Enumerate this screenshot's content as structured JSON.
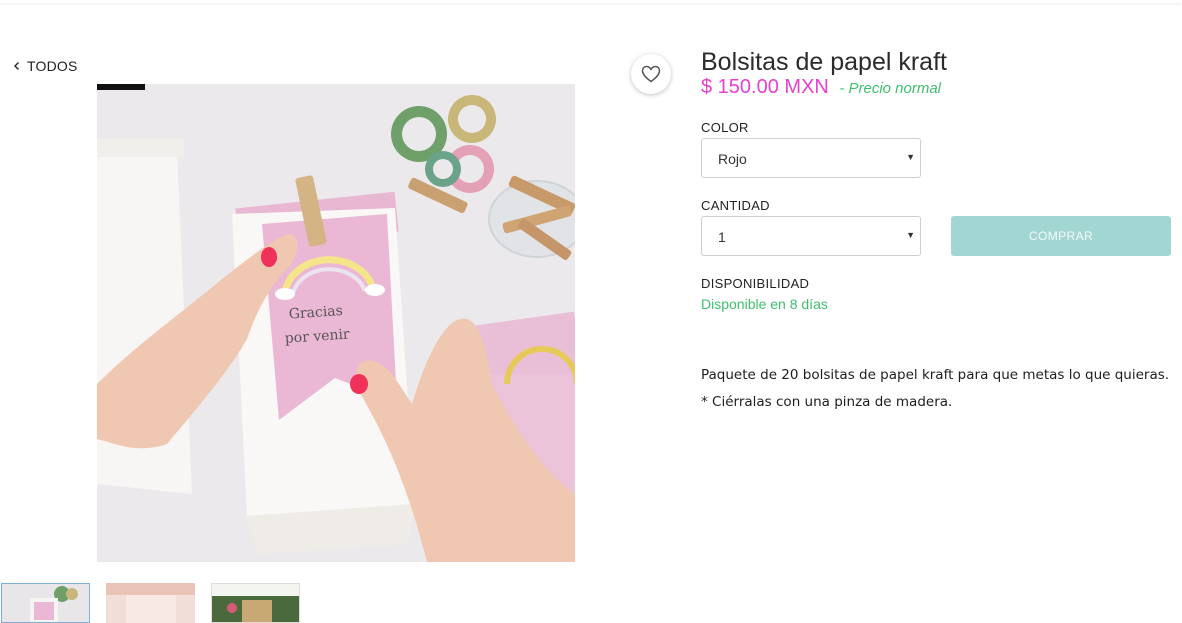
{
  "nav": {
    "back_label": "TODOS"
  },
  "product": {
    "title": "Bolsitas de papel kraft",
    "price": "$ 150.00 MXN",
    "price_note": "- Precio normal",
    "image_text": [
      "Gracias",
      "por venir"
    ]
  },
  "options": {
    "color_label": "COLOR",
    "color_value": "Rojo",
    "quantity_label": "CANTIDAD",
    "quantity_value": "1",
    "availability_label": "DISPONIBILIDAD",
    "availability_value": "Disponible en 8 días"
  },
  "actions": {
    "buy_label": "COMPRAR"
  },
  "description": {
    "line1": "Paquete de 20 bolsitas de papel kraft para que metas lo que quieras.",
    "line2": "* Ciérralas con una pinza de madera."
  },
  "colors": {
    "price": "#e83fcf",
    "success": "#3fbf6e",
    "button": "#a2d6d2"
  },
  "icons": {
    "back": "chevron-left-icon",
    "favorite": "heart-icon",
    "select": "caret-down-icon"
  }
}
